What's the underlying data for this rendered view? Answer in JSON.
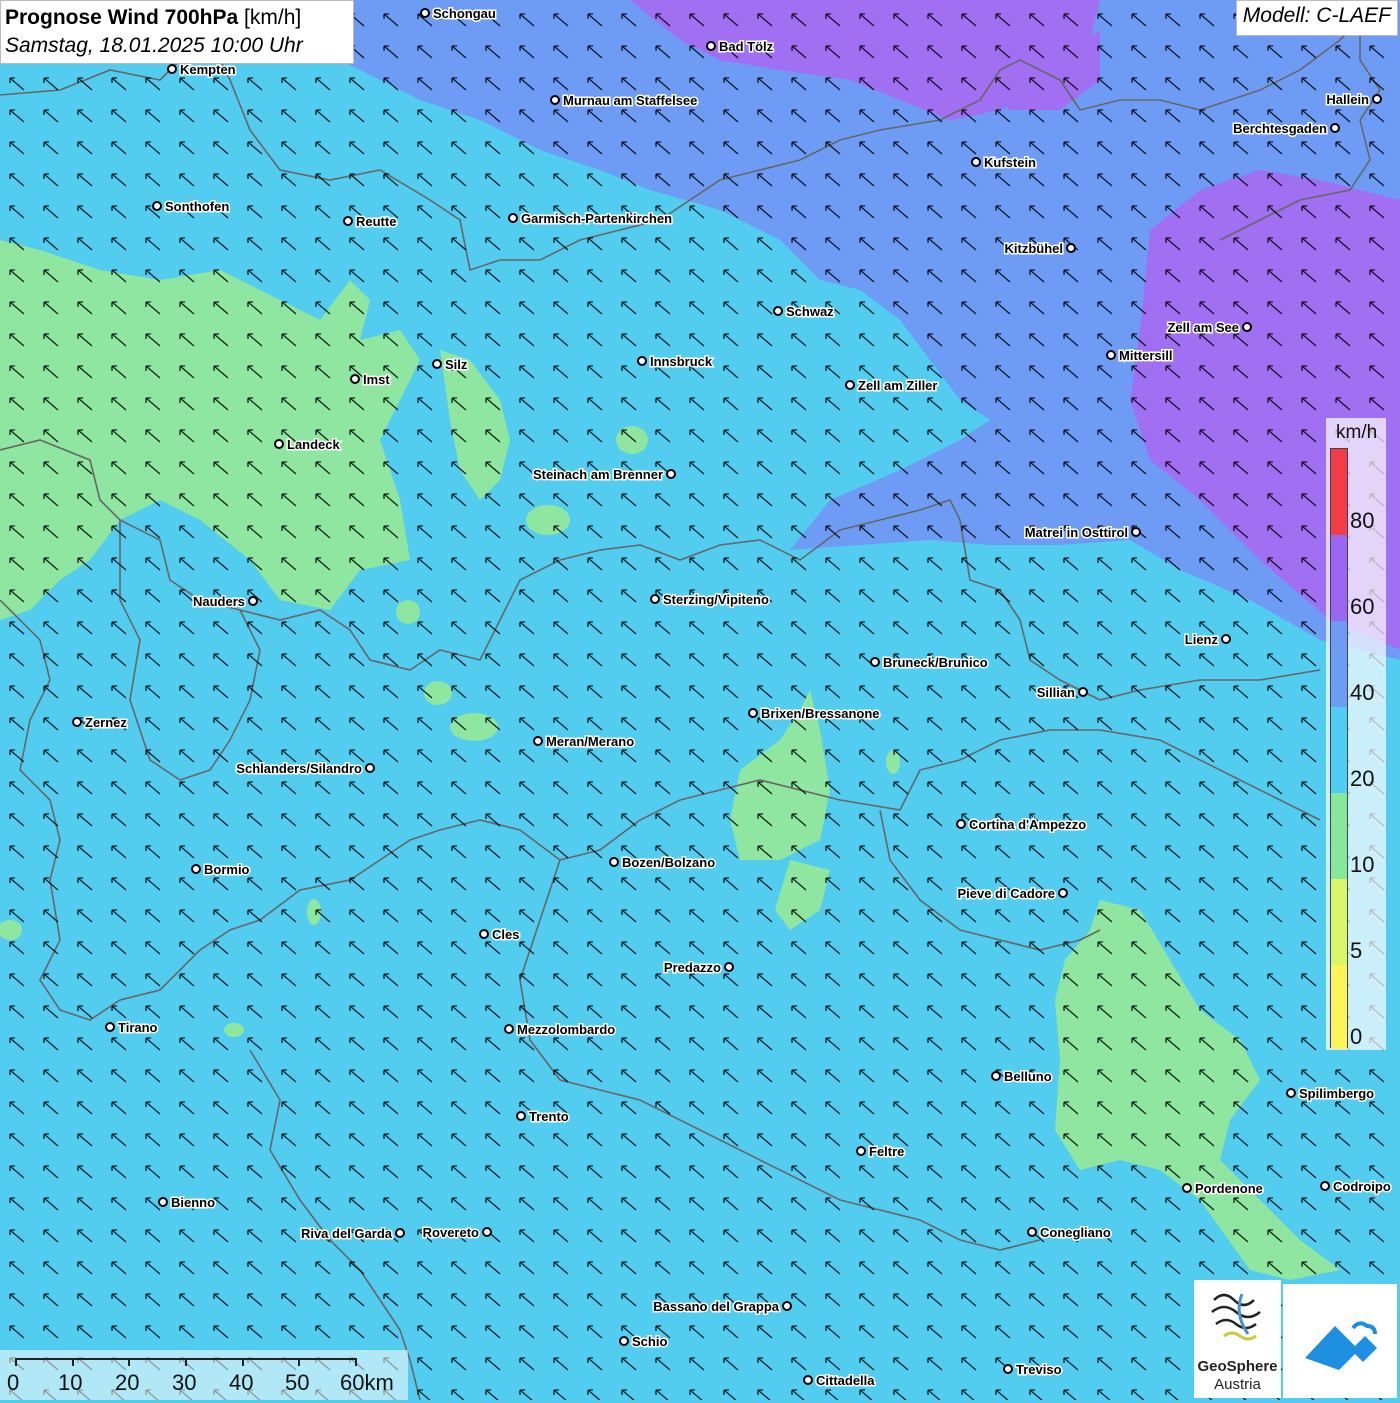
{
  "title": {
    "main": "Prognose Wind 700hPa",
    "unit": "[km/h]",
    "datetime": "Samstag, 18.01.2025 10:00 Uhr"
  },
  "model": "Modell: C-LAEF",
  "legend": {
    "unit": "km/h",
    "levels": [
      {
        "label": "0",
        "color": "#fcf55a"
      },
      {
        "label": "5",
        "color": "#d9f56a"
      },
      {
        "label": "10",
        "color": "#86e89a"
      },
      {
        "label": "20",
        "color": "#4fcdf3"
      },
      {
        "label": "40",
        "color": "#6e9cf5"
      },
      {
        "label": "60",
        "color": "#9a66f2"
      },
      {
        "label": "80",
        "color": "#f23c48"
      }
    ]
  },
  "scale_bar": {
    "labels": [
      "0",
      "10",
      "20",
      "30",
      "40",
      "50",
      "60km"
    ]
  },
  "colors": {
    "background": "#52cdf0",
    "calm_zone": "#8fe6a0",
    "strong_zone": "#6e9cf5",
    "very_strong_zone": "#a16ff2",
    "border": "#666666",
    "arrow": "#000000"
  },
  "wind_direction": "from south-east",
  "cities": [
    {
      "name": "Schongau"
    },
    {
      "name": "Bad Tölz"
    },
    {
      "name": "Kempten"
    },
    {
      "name": "Murnau am Staffelsee"
    },
    {
      "name": "Hallein"
    },
    {
      "name": "Berchtesgaden"
    },
    {
      "name": "Kufstein"
    },
    {
      "name": "Sonthofen"
    },
    {
      "name": "Reutte"
    },
    {
      "name": "Garmisch-Partenkirchen"
    },
    {
      "name": "Kitzbühel"
    },
    {
      "name": "Schwaz"
    },
    {
      "name": "Zell am See"
    },
    {
      "name": "Silz"
    },
    {
      "name": "Innsbruck"
    },
    {
      "name": "Mittersill"
    },
    {
      "name": "Imst"
    },
    {
      "name": "Zell am Ziller"
    },
    {
      "name": "Landeck"
    },
    {
      "name": "Steinach am Brenner"
    },
    {
      "name": "Matrei in Osttirol"
    },
    {
      "name": "Nauders"
    },
    {
      "name": "Sterzing/Vipiteno"
    },
    {
      "name": "Lienz"
    },
    {
      "name": "Bruneck/Brunico"
    },
    {
      "name": "Sillian"
    },
    {
      "name": "Brixen/Bressanone"
    },
    {
      "name": "Zernez"
    },
    {
      "name": "Meran/Merano"
    },
    {
      "name": "Schlanders/Silandro"
    },
    {
      "name": "Cortina d'Ampezzo"
    },
    {
      "name": "Bozen/Bolzano"
    },
    {
      "name": "Bormio"
    },
    {
      "name": "Pieve di Cadore"
    },
    {
      "name": "Cles"
    },
    {
      "name": "Predazzo"
    },
    {
      "name": "Tirano"
    },
    {
      "name": "Mezzolombardo"
    },
    {
      "name": "Belluno"
    },
    {
      "name": "Spilimbergo"
    },
    {
      "name": "Trento"
    },
    {
      "name": "Feltre"
    },
    {
      "name": "Pordenone"
    },
    {
      "name": "Codroipo"
    },
    {
      "name": "Bienno"
    },
    {
      "name": "Riva del Garda"
    },
    {
      "name": "Rovereto"
    },
    {
      "name": "Conegliano"
    },
    {
      "name": "Bassano del Grappa"
    },
    {
      "name": "Schio"
    },
    {
      "name": "Treviso"
    },
    {
      "name": "Cittadella"
    }
  ],
  "logos": {
    "geosphere_line1": "GeoSphere",
    "geosphere_line2": "Austria"
  }
}
